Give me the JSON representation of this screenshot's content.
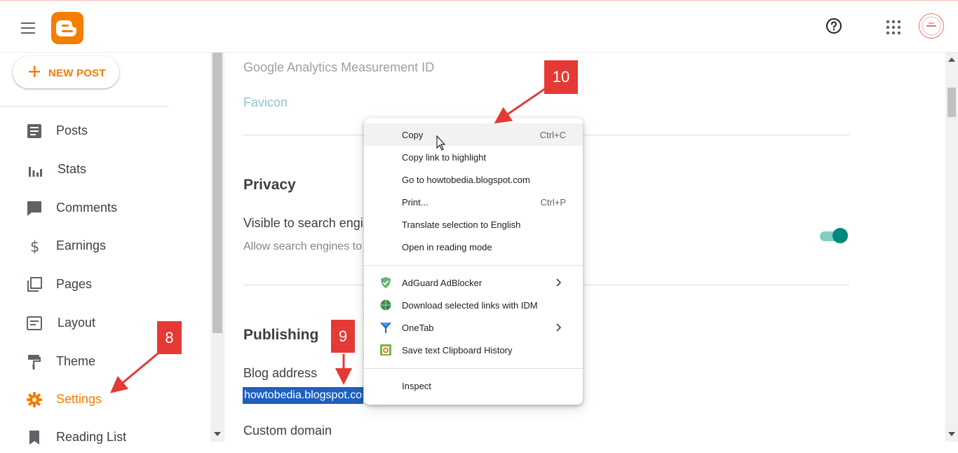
{
  "header": {
    "menu_icon": "hamburger-menu-icon",
    "logo": "blogger-logo",
    "help_icon": "help-icon",
    "apps_icon": "apps-grid-icon",
    "avatar": "account-avatar"
  },
  "sidebar": {
    "new_post_label": "NEW POST",
    "items": [
      {
        "label": "Posts",
        "icon": "posts-icon"
      },
      {
        "label": "Stats",
        "icon": "stats-icon"
      },
      {
        "label": "Comments",
        "icon": "comments-icon"
      },
      {
        "label": "Earnings",
        "icon": "dollar-icon"
      },
      {
        "label": "Pages",
        "icon": "pages-icon"
      },
      {
        "label": "Layout",
        "icon": "layout-icon"
      },
      {
        "label": "Theme",
        "icon": "paint-roller-icon"
      },
      {
        "label": "Settings",
        "icon": "gear-icon",
        "active": true
      },
      {
        "label": "Reading List",
        "icon": "bookmark-icon"
      }
    ]
  },
  "main": {
    "analytics_label": "Google Analytics Measurement ID",
    "favicon_label": "Favicon",
    "privacy": {
      "heading": "Privacy",
      "visible_label": "Visible to search engi",
      "visible_sub": "Allow search engines to",
      "toggle_on": true
    },
    "publishing": {
      "heading": "Publishing",
      "blog_address_label": "Blog address",
      "blog_address_value": "howtobedia.blogspot.co",
      "custom_domain_label": "Custom domain"
    }
  },
  "context_menu": {
    "items": [
      {
        "label": "Copy",
        "shortcut": "Ctrl+C"
      },
      {
        "label": "Copy link to highlight"
      },
      {
        "label": "Go to howtobedia.blogspot.com"
      },
      {
        "label": "Print...",
        "shortcut": "Ctrl+P"
      },
      {
        "label": "Translate selection to English"
      },
      {
        "label": "Open in reading mode"
      }
    ],
    "extensions": [
      {
        "label": "AdGuard AdBlocker",
        "icon": "adguard-shield-icon",
        "submenu": true
      },
      {
        "label": "Download selected links with IDM",
        "icon": "idm-globe-icon"
      },
      {
        "label": "OneTab",
        "icon": "onetab-funnel-icon",
        "submenu": true
      },
      {
        "label": "Save text Clipboard History",
        "icon": "clipboard-history-icon"
      }
    ],
    "inspect_label": "Inspect"
  },
  "callouts": {
    "step8": "8",
    "step9": "9",
    "step10": "10"
  },
  "colors": {
    "brand_orange": "#f57d00",
    "toggle_teal": "#00897b",
    "callout_red": "#e53935",
    "selection_blue": "#1e5fbf"
  }
}
